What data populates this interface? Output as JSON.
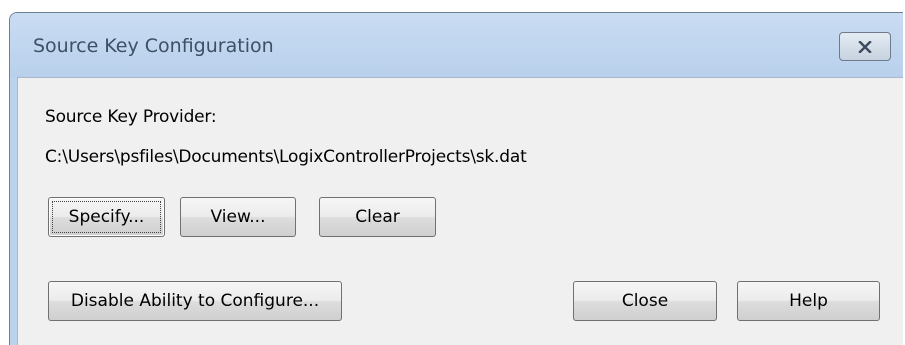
{
  "window": {
    "title": "Source Key Configuration",
    "close_icon": "close-x-icon"
  },
  "content": {
    "provider_label": "Source Key Provider:",
    "provider_path": "C:\\Users\\psfiles\\Documents\\LogixControllerProjects\\sk.dat"
  },
  "buttons": {
    "specify": "Specify...",
    "view": "View...",
    "clear": "Clear",
    "disable": "Disable Ability to Configure...",
    "close": "Close",
    "help": "Help"
  },
  "colors": {
    "frame": "#bcd3ee",
    "client": "#f0f0f0"
  }
}
